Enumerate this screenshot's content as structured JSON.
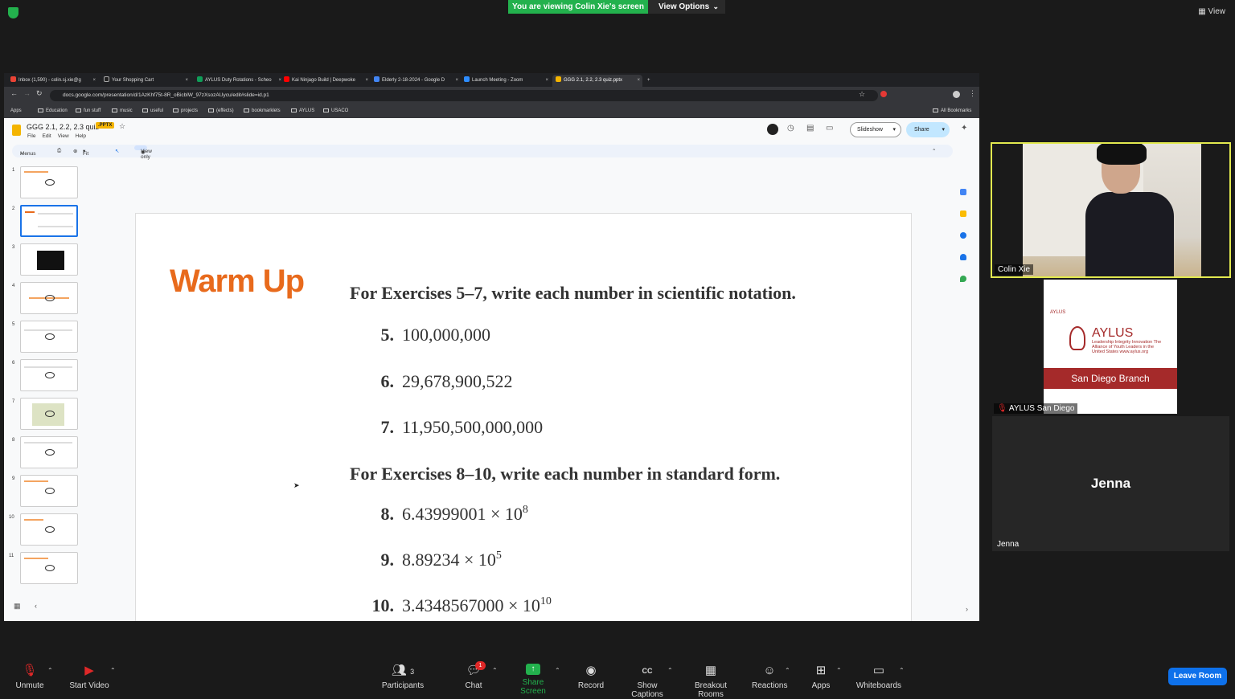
{
  "zoom": {
    "banner": "You are viewing Colin Xie's screen",
    "view_options": "View Options",
    "view": "View",
    "participants": [
      {
        "name": "Colin Xie"
      },
      {
        "name": "AYLUS San Diego"
      },
      {
        "name": "Jenna",
        "display": "Jenna"
      }
    ],
    "aylus_card": {
      "small": "AYLUS",
      "logo": "AYLUS",
      "sub": "Leadership Integrity Innovation\nThe Alliance of Youth Leaders in the United States\nwww.aylus.org",
      "branch": "San Diego Branch"
    },
    "toolbar": {
      "unmute": "Unmute",
      "start_video": "Start Video",
      "participants": "Participants",
      "participants_count": "3",
      "chat": "Chat",
      "chat_badge": "1",
      "share_screen": "Share Screen",
      "record": "Record",
      "show_captions": "Show Captions",
      "captions_icon": "CC",
      "breakout_rooms": "Breakout Rooms",
      "reactions": "Reactions",
      "apps": "Apps",
      "whiteboards": "Whiteboards",
      "leave": "Leave Room"
    }
  },
  "browser": {
    "tabs": [
      {
        "label": "Inbox (1,590) - colin.sj.xie@g",
        "color": "#ea4335"
      },
      {
        "label": "Your Shopping Cart",
        "color": "#222222"
      },
      {
        "label": "AYLUS Duty Rotations - Scheo",
        "color": "#0f9d58"
      },
      {
        "label": "Kai Ninjago Build | Deepwoke",
        "color": "#ff0000"
      },
      {
        "label": "Elderly 2-18-2024 - Google D",
        "color": "#4285f4"
      },
      {
        "label": "Launch Meeting - Zoom",
        "color": "#2d8cff"
      },
      {
        "label": "GGG 2.1, 2.2, 2.3 quiz.pptx",
        "color": "#f4b400"
      }
    ],
    "new_tab": "+",
    "url": "docs.google.com/presentation/d/1AzKhf75t-8R_oBicblW_97zXsozAUycu/edit#slide=id.p1",
    "bookmarks": [
      "Apps",
      "Education",
      "fun stuff",
      "music",
      "useful",
      "projects",
      "(effects)",
      "bookmarklets",
      "AYLUS",
      "USACO"
    ],
    "all_bookmarks": "All Bookmarks"
  },
  "slides": {
    "title": "GGG 2.1, 2.2, 2.3 quiz",
    "badge": ".PPTX",
    "menu": [
      "File",
      "Edit",
      "View",
      "Help"
    ],
    "slideshow": "Slideshow",
    "share": "Share",
    "toolbar": {
      "menus": "Menus",
      "zoom": "Fit",
      "view_only": "View only"
    },
    "thumbnail_numbers": [
      "1",
      "2",
      "3",
      "4",
      "5",
      "6",
      "7",
      "8",
      "9",
      "10",
      "11"
    ],
    "current_slide": {
      "title": "Warm Up",
      "heading1": "For Exercises 5–7, write each number in scientific notation.",
      "items1": [
        {
          "n": "5.",
          "text": "100,000,000"
        },
        {
          "n": "6.",
          "text": "29,678,900,522"
        },
        {
          "n": "7.",
          "text": "11,950,500,000,000"
        }
      ],
      "heading2": "For Exercises 8–10, write each number in standard form.",
      "items2": [
        {
          "n": "8.",
          "base": "6.43999001 × 10",
          "exp": "8"
        },
        {
          "n": "9.",
          "base": "8.89234 × 10",
          "exp": "5"
        },
        {
          "n": "10.",
          "base": "3.4348567000 × 10",
          "exp": "10"
        }
      ]
    }
  }
}
